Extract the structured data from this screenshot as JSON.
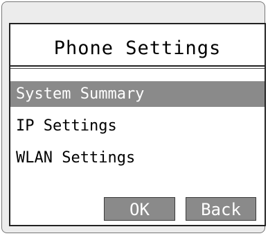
{
  "screen": {
    "title": "Phone Settings"
  },
  "menu": {
    "items": [
      {
        "label": "System Summary",
        "selected": true
      },
      {
        "label": "IP Settings",
        "selected": false
      },
      {
        "label": "WLAN Settings",
        "selected": false
      }
    ]
  },
  "softkeys": {
    "ok_label": "OK",
    "back_label": "Back"
  },
  "colors": {
    "selection_bg": "#8a8a8a",
    "frame_bg": "#ececec"
  }
}
